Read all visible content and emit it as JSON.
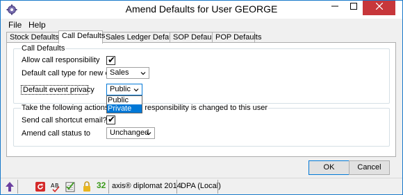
{
  "window": {
    "title": "Amend Defaults for User GEORGE",
    "min_label": "—",
    "max_label": "☐",
    "close_label": "✕"
  },
  "menu": {
    "file": "File",
    "help": "Help"
  },
  "tabs": [
    {
      "label": "Stock Defaults"
    },
    {
      "label": "Call Defaults"
    },
    {
      "label": "Sales Ledger Defaults"
    },
    {
      "label": "SOP Defaults"
    },
    {
      "label": "POP Defaults"
    }
  ],
  "call_defaults": {
    "legend": "Call Defaults",
    "allow_label": "Allow call responsibility",
    "allow_checked": true,
    "call_type_label": "Default call type for new calls",
    "call_type_value": "Sales",
    "privacy_label": "Default event privacy",
    "privacy_value": "Public",
    "privacy_options": [
      "Public",
      "Private"
    ],
    "privacy_highlighted": "Private"
  },
  "responsibility": {
    "legend": "Take the following actions when call responsibility is changed to this user",
    "email_label": "Send call shortcut email?",
    "email_checked": true,
    "status_label": "Amend call status to",
    "status_value": "Unchanged"
  },
  "buttons": {
    "ok": "OK",
    "cancel": "Cancel"
  },
  "statusbar": {
    "badge_number": "32",
    "product": "axis® diplomat 2014",
    "database": "DPA (Local)"
  },
  "colors": {
    "accent": "#0078d7",
    "close": "#c7373b",
    "badge_green": "#3a9a1a"
  }
}
